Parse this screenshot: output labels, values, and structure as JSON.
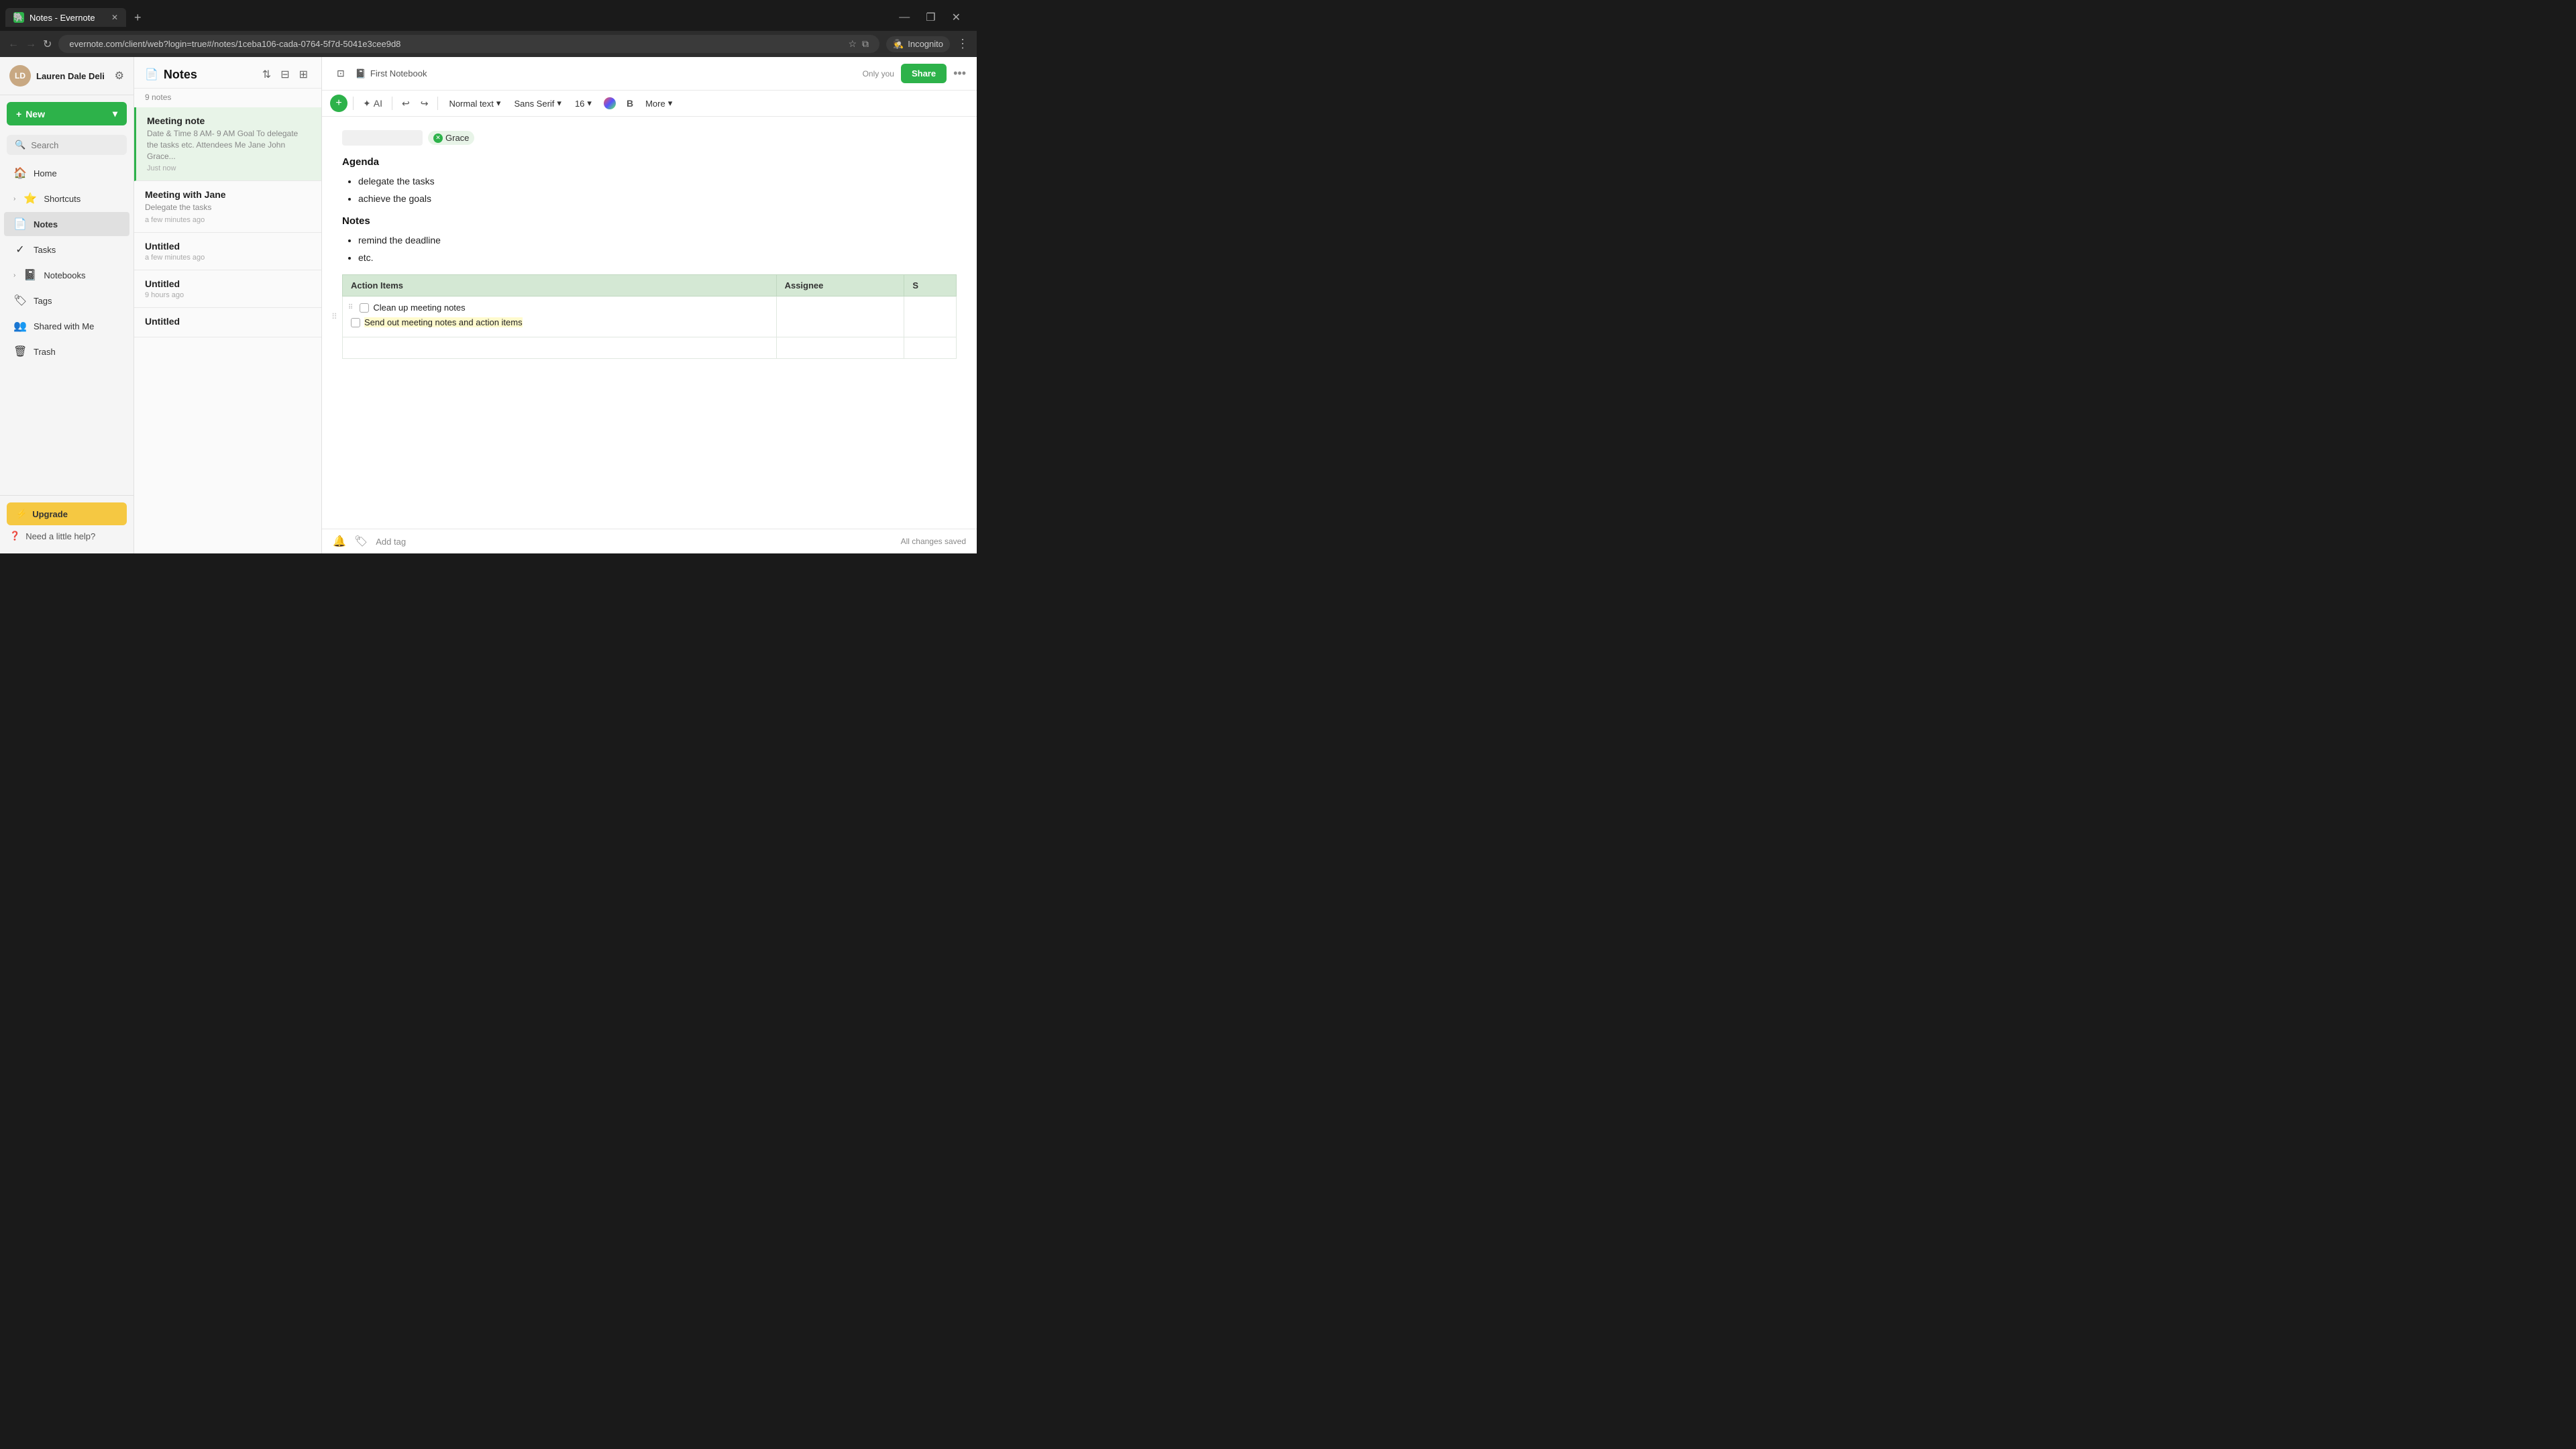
{
  "browser": {
    "tab_title": "Notes - Evernote",
    "tab_favicon": "🐘",
    "close_icon": "✕",
    "new_tab_icon": "+",
    "back_icon": "←",
    "forward_icon": "→",
    "refresh_icon": "↻",
    "address": "evernote.com/client/web?login=true#/notes/1ceba106-cada-0764-5f7d-5041e3cee9d8",
    "star_icon": "☆",
    "window_icon": "⧉",
    "incognito_label": "Incognito",
    "more_icon": "⋮",
    "minimize_icon": "—",
    "maximize_icon": "❐",
    "window_close_icon": "✕"
  },
  "sidebar": {
    "user_name": "Lauren Dale Deli",
    "user_initials": "LD",
    "gear_icon": "⚙",
    "new_label": "New",
    "new_chevron": "▾",
    "search_placeholder": "Search",
    "nav_items": [
      {
        "id": "home",
        "icon": "🏠",
        "label": "Home"
      },
      {
        "id": "shortcuts",
        "icon": "⭐",
        "label": "Shortcuts",
        "expand": "›"
      },
      {
        "id": "notes",
        "icon": "📄",
        "label": "Notes",
        "active": true
      },
      {
        "id": "tasks",
        "icon": "✓",
        "label": "Tasks"
      },
      {
        "id": "notebooks",
        "icon": "📓",
        "label": "Notebooks",
        "expand": "›"
      },
      {
        "id": "tags",
        "icon": "🏷",
        "label": "Tags"
      },
      {
        "id": "shared",
        "icon": "👥",
        "label": "Shared with Me"
      },
      {
        "id": "trash",
        "icon": "🗑",
        "label": "Trash"
      }
    ],
    "upgrade_label": "Upgrade",
    "upgrade_icon": "⚡",
    "help_label": "Need a little help?",
    "help_icon": "?"
  },
  "notes_panel": {
    "title": "Notes",
    "icon": "📄",
    "count": "9 notes",
    "sort_icon": "⇅",
    "filter_icon": "⊟",
    "view_icon": "⊞",
    "notes": [
      {
        "id": "meeting-note",
        "title": "Meeting note",
        "preview": "Date & Time 8 AM- 9 AM Goal To delegate the tasks etc. Attendees Me Jane John Grace...",
        "time": "Just now",
        "active": true
      },
      {
        "id": "meeting-jane",
        "title": "Meeting with Jane",
        "preview": "Delegate the tasks",
        "time": "a few minutes ago",
        "active": false
      },
      {
        "id": "untitled-1",
        "title": "Untitled",
        "preview": "",
        "time": "a few minutes ago",
        "active": false
      },
      {
        "id": "untitled-2",
        "title": "Untitled",
        "preview": "",
        "time": "9 hours ago",
        "active": false
      },
      {
        "id": "untitled-3",
        "title": "Untitled",
        "preview": "",
        "time": "",
        "active": false
      }
    ]
  },
  "editor": {
    "notebook_icon": "📓",
    "notebook_name": "First Notebook",
    "expand_icon": "▾",
    "only_you": "Only you",
    "share_label": "Share",
    "more_icon": "•••",
    "layout_icon": "⊡",
    "toolbar": {
      "plus_icon": "+",
      "undo_icon": "↩",
      "redo_icon": "↪",
      "ai_label": "AI",
      "normal_text_label": "Normal text",
      "dropdown_icon": "▾",
      "font_label": "Sans Serif",
      "font_size": "16",
      "color_label": "color",
      "bold_label": "B",
      "more_label": "More",
      "more_dropdown": "▾"
    },
    "content": {
      "attendee_label": "Grace",
      "attendee_x": "✕",
      "agenda_heading": "Agenda",
      "agenda_items": [
        "delegate the tasks",
        "achieve the goals"
      ],
      "notes_heading": "Notes",
      "notes_items": [
        "remind the deadline",
        "etc."
      ],
      "table": {
        "col1": "Action Items",
        "col2": "Assignee",
        "col3": "S",
        "rows": [
          {
            "task1": "Clean up meeting notes",
            "task2": "Send out meeting notes and action items",
            "task2_highlighted": true
          }
        ]
      }
    },
    "footer": {
      "bell_icon": "🔔",
      "tag_icon": "🏷",
      "add_tag_label": "Add tag",
      "save_status": "All changes saved"
    }
  }
}
